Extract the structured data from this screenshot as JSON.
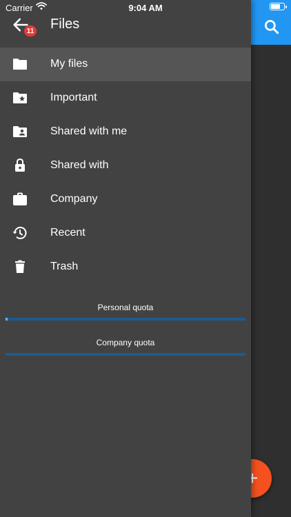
{
  "status_bar": {
    "carrier": "Carrier",
    "time": "9:04 AM",
    "battery_level": 0.75
  },
  "drawer": {
    "title": "Files",
    "badge": "11",
    "items": [
      {
        "label": "My files",
        "icon": "folder-icon",
        "active": true
      },
      {
        "label": "Important",
        "icon": "folder-star-icon"
      },
      {
        "label": "Shared with me",
        "icon": "folder-shared-icon"
      },
      {
        "label": "Shared with",
        "icon": "lock-icon"
      },
      {
        "label": "Company",
        "icon": "briefcase-icon"
      },
      {
        "label": "Recent",
        "icon": "history-icon"
      },
      {
        "label": "Trash",
        "icon": "trash-icon"
      }
    ],
    "quotas": [
      {
        "label": "Personal quota",
        "used_fraction": 0.01
      },
      {
        "label": "Company quota",
        "used_fraction": 0.0
      }
    ]
  },
  "background": {
    "fab_label": "+",
    "accent_color": "#2196f3",
    "fab_color": "#f4511e"
  }
}
